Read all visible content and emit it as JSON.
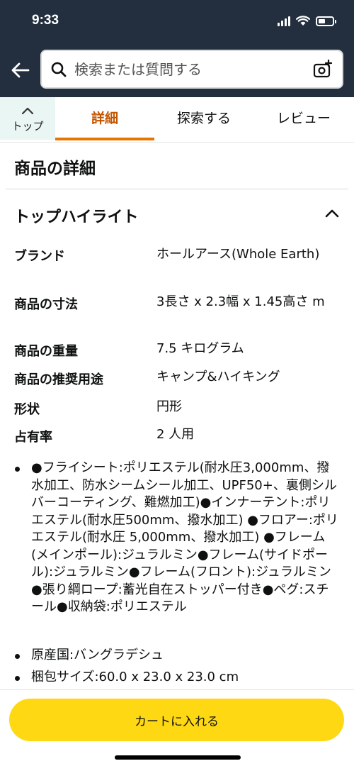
{
  "status": {
    "time": "9:33",
    "battery_level": 0.5
  },
  "header": {
    "search_placeholder": "検索または質問する"
  },
  "tabs": {
    "top_label": "トップ",
    "items": [
      {
        "label": "詳細",
        "active": true
      },
      {
        "label": "探索する",
        "active": false
      },
      {
        "label": "レビュー",
        "active": false
      }
    ]
  },
  "details": {
    "section_title": "商品の詳細",
    "highlight_title": "トップハイライト",
    "specs": [
      {
        "key": "ブランド",
        "value": "ホールアース(Whole Earth)"
      },
      {
        "key": "商品の寸法",
        "value": "3長さ x 2.3幅 x 1.45高さ m"
      },
      {
        "key": "商品の重量",
        "value": "7.5 キログラム"
      },
      {
        "key": "商品の推奨用途",
        "value": "キャンプ&ハイキング"
      },
      {
        "key": "形状",
        "value": "円形"
      },
      {
        "key": "占有率",
        "value": "2 人用"
      }
    ],
    "bullets": [
      "●フライシート:ポリエステル(耐水圧3,000mm、撥水加工、防水シームシール加工、UPF50+、裏側シルバーコーティング、難燃加工)●インナーテント:ポリエステル(耐水圧500mm、撥水加工) ●フロアー:ポリエステル(耐水圧 5,000mm、撥水加工) ●フレーム(メインポール):ジュラルミン●フレーム(サイドポール):ジュラルミン●フレーム(フロント):ジュラルミン●張り綱ロープ:蓄光自在ストッパー付き●ペグ:スチール●収納袋:ポリエステル",
      "原産国:バングラデシュ",
      "梱包サイズ:60.0 x 23.0 x 23.0 cm"
    ]
  },
  "cart": {
    "label": "カートに入れる",
    "color": "#ffd814"
  },
  "colors": {
    "header_bg": "#232f3e",
    "active_tab": "#c45500",
    "tab_underline": "#e77600"
  }
}
